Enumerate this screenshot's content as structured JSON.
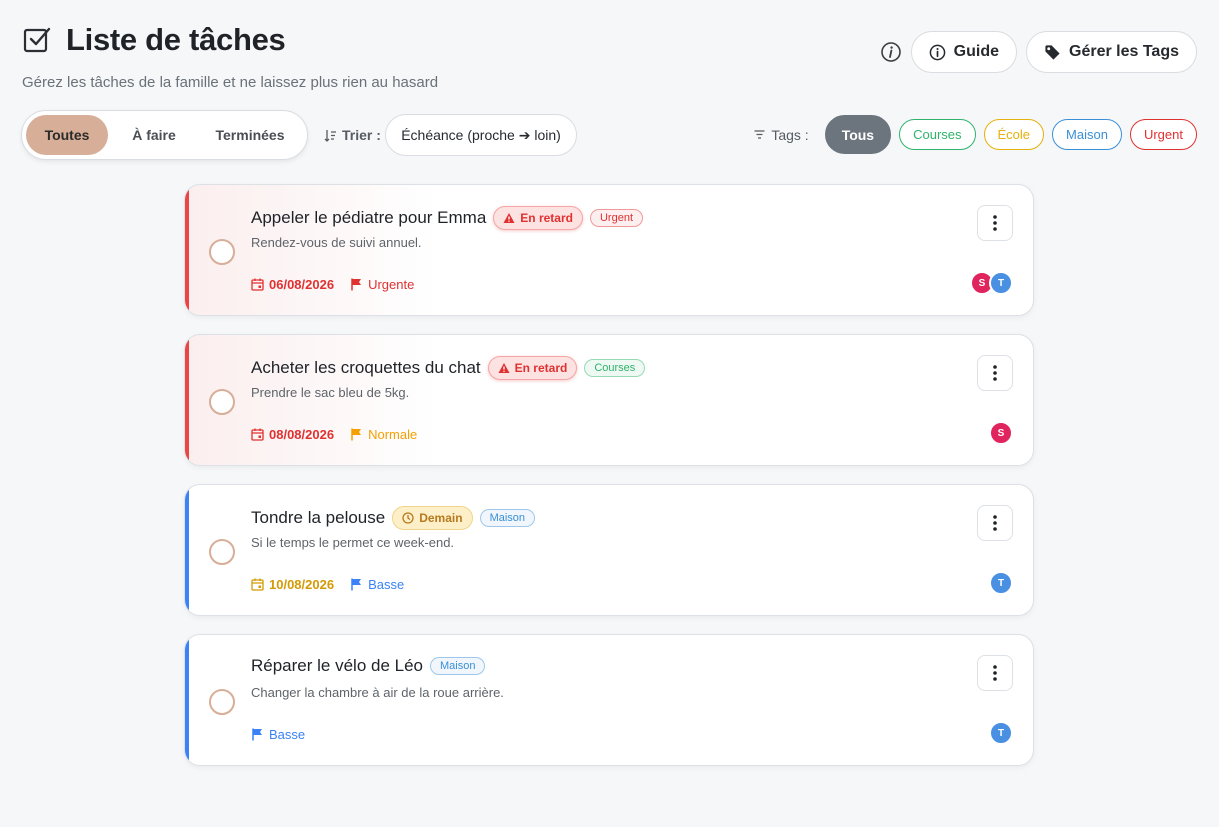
{
  "header": {
    "title": "Liste de tâches",
    "subtitle": "Gérez les tâches de la famille et ne laissez plus rien au hasard",
    "guide_label": "Guide",
    "manage_tags_label": "Gérer les Tags"
  },
  "filters": {
    "tabs": [
      "Toutes",
      "À faire",
      "Terminées"
    ],
    "active": "Toutes",
    "sort_label": "Trier :",
    "sort_value": "Échéance (proche ➔ loin)",
    "tags_label": "Tags :",
    "tag_chips": [
      {
        "label": "Tous",
        "color": "#6c757d",
        "active": true
      },
      {
        "label": "Courses",
        "color": "#2fb36b"
      },
      {
        "label": "École",
        "color": "#e5b10c"
      },
      {
        "label": "Maison",
        "color": "#3b8fd6"
      },
      {
        "label": "Urgent",
        "color": "#e03131"
      }
    ]
  },
  "tasks": [
    {
      "title": "Appeler le pédiatre pour Emma",
      "status_badge": "En retard",
      "tag": "Urgent",
      "tag_color": "#e03131",
      "description": "Rendez-vous de suivi annuel.",
      "due_date": "06/08/2026",
      "date_color": "#e03131",
      "priority": "Urgente",
      "priority_color": "#e03131",
      "stripe_color": "#e94545",
      "assignees": [
        {
          "initial": "S",
          "color": "#e0245e"
        },
        {
          "initial": "T",
          "color": "#4a90e2"
        }
      ]
    },
    {
      "title": "Acheter les croquettes du chat",
      "status_badge": "En retard",
      "tag": "Courses",
      "tag_color": "#2fb36b",
      "description": "Prendre le sac bleu de 5kg.",
      "due_date": "08/08/2026",
      "date_color": "#e03131",
      "priority": "Normale",
      "priority_color": "#f59f00",
      "stripe_color": "#e94545",
      "assignees": [
        {
          "initial": "S",
          "color": "#e0245e"
        }
      ]
    },
    {
      "title": "Tondre la pelouse",
      "status_badge": "Demain",
      "tag": "Maison",
      "tag_color": "#3b8fd6",
      "description": "Si le temps le permet ce week-end.",
      "due_date": "10/08/2026",
      "date_color": "#d39a06",
      "priority": "Basse",
      "priority_color": "#3b82f6",
      "stripe_color": "#3b82f6",
      "assignees": [
        {
          "initial": "T",
          "color": "#4a90e2"
        }
      ]
    },
    {
      "title": "Réparer le vélo de Léo",
      "status_badge": "",
      "tag": "Maison",
      "tag_color": "#3b8fd6",
      "description": "Changer la chambre à air de la roue arrière.",
      "due_date": "",
      "date_color": "",
      "priority": "Basse",
      "priority_color": "#3b82f6",
      "stripe_color": "#3b82f6",
      "assignees": [
        {
          "initial": "T",
          "color": "#4a90e2"
        }
      ]
    }
  ]
}
